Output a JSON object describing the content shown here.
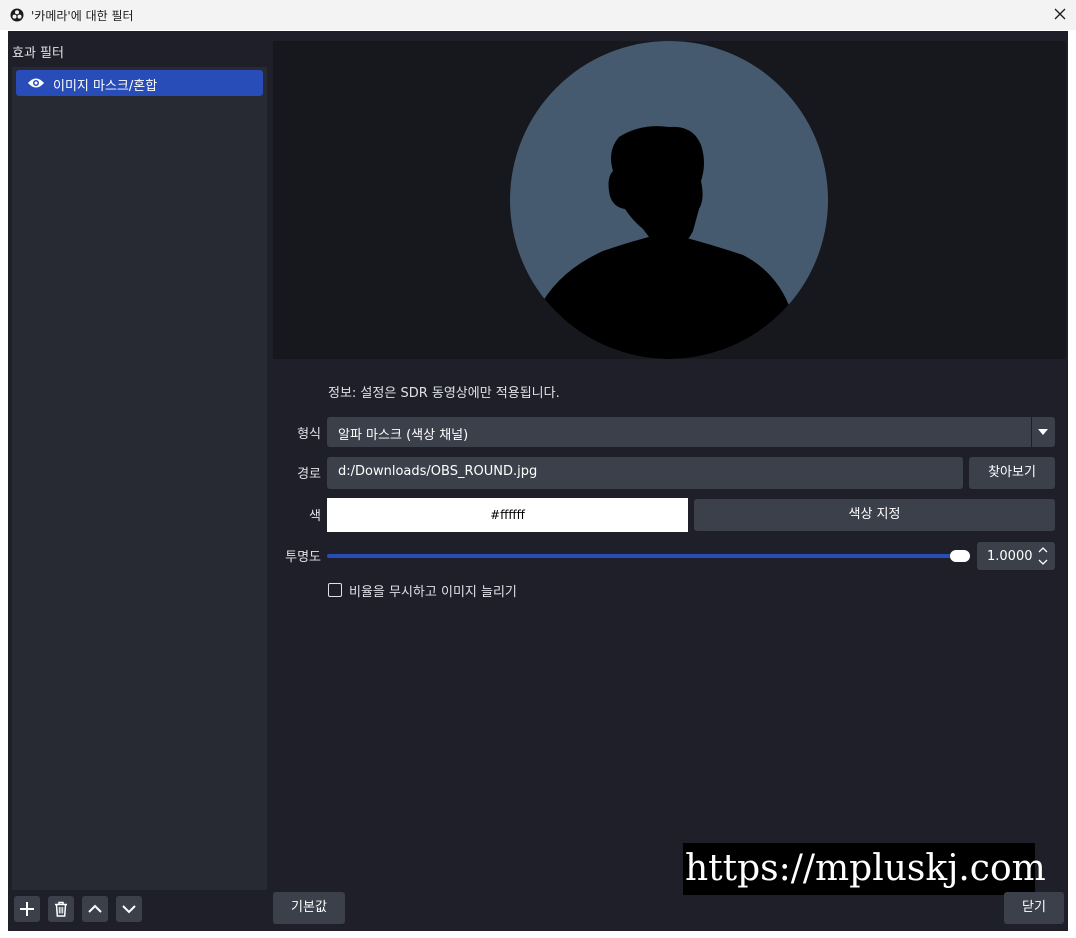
{
  "window": {
    "title": "'카메라'에 대한 필터",
    "app_icon": "obs-icon",
    "close_icon": "close-icon"
  },
  "sidebar": {
    "label": "효과 필터",
    "items": [
      {
        "label": "이미지 마스크/혼합",
        "icon": "eye-icon",
        "selected": true
      }
    ],
    "toolbar": [
      "add-icon",
      "trash-icon",
      "chevron-up-icon",
      "chevron-down-icon"
    ]
  },
  "main": {
    "info": "정보: 설정은 SDR 동영상에만 적용됩니다.",
    "type": {
      "label": "형식",
      "value": "알파 마스크 (색상 채널)"
    },
    "path": {
      "label": "경로",
      "value": "d:/Downloads/OBS_ROUND.jpg",
      "browse_label": "찾아보기"
    },
    "color": {
      "label": "색",
      "value": "#ffffff",
      "pick_label": "색상 지정"
    },
    "opacity": {
      "label": "투명도",
      "value": "1.0000",
      "fraction": 1.0
    },
    "stretch": {
      "label": "비율을 무시하고 이미지 늘리기",
      "checked": false
    }
  },
  "footer": {
    "defaults_label": "기본값",
    "close_label": "닫기"
  },
  "watermark": "https://mpluskj.com",
  "colors": {
    "accent": "#284cb8",
    "background": "#1e1f28",
    "panel": "#272a33",
    "control": "#3c404b",
    "preview_bg": "#17181e",
    "avatar_bg": "#455a6e"
  }
}
